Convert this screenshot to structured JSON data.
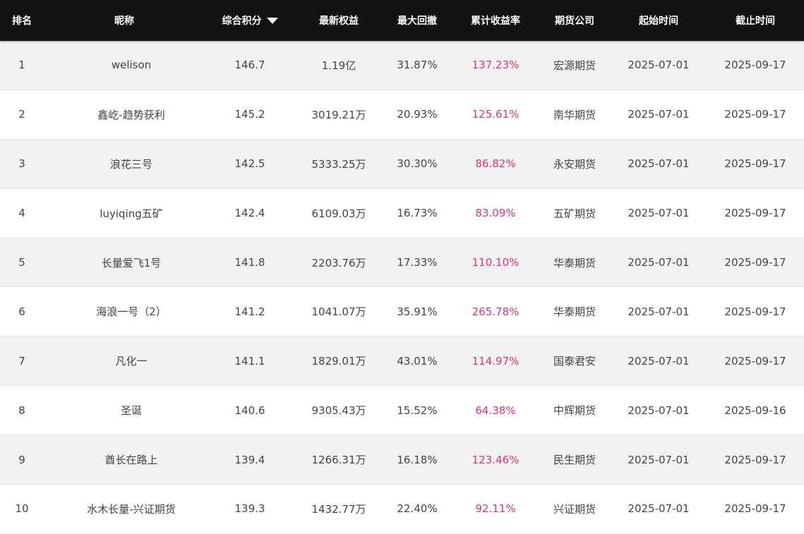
{
  "headers": {
    "rank": "排名",
    "nickname": "昵称",
    "score": "综合积分",
    "equity": "最新权益",
    "drawdown": "最大回撤",
    "return": "累计收益率",
    "company": "期货公司",
    "start": "起始时间",
    "end": "截止时间"
  },
  "sort_icon": "sort-down-triangle-icon",
  "colors": {
    "header_bg": "#121212",
    "return_color": "#e8317a",
    "row_alt_bg": "#f2f2f2"
  },
  "rows": [
    {
      "rank": "1",
      "nickname": "welison",
      "score": "146.7",
      "equity": "1.19亿",
      "drawdown": "31.87%",
      "return": "137.23%",
      "company": "宏源期货",
      "start": "2025-07-01",
      "end": "2025-09-17"
    },
    {
      "rank": "2",
      "nickname": "鑫屹-趋势获利",
      "score": "145.2",
      "equity": "3019.21万",
      "drawdown": "20.93%",
      "return": "125.61%",
      "company": "南华期货",
      "start": "2025-07-01",
      "end": "2025-09-17"
    },
    {
      "rank": "3",
      "nickname": "浪花三号",
      "score": "142.5",
      "equity": "5333.25万",
      "drawdown": "30.30%",
      "return": "86.82%",
      "company": "永安期货",
      "start": "2025-07-01",
      "end": "2025-09-17"
    },
    {
      "rank": "4",
      "nickname": "luyiqing五矿",
      "score": "142.4",
      "equity": "6109.03万",
      "drawdown": "16.73%",
      "return": "83.09%",
      "company": "五矿期货",
      "start": "2025-07-01",
      "end": "2025-09-17"
    },
    {
      "rank": "5",
      "nickname": "长量爱飞1号",
      "score": "141.8",
      "equity": "2203.76万",
      "drawdown": "17.33%",
      "return": "110.10%",
      "company": "华泰期货",
      "start": "2025-07-01",
      "end": "2025-09-17"
    },
    {
      "rank": "6",
      "nickname": "海浪一号（2）",
      "score": "141.2",
      "equity": "1041.07万",
      "drawdown": "35.91%",
      "return": "265.78%",
      "company": "华泰期货",
      "start": "2025-07-01",
      "end": "2025-09-17"
    },
    {
      "rank": "7",
      "nickname": "凡化一",
      "score": "141.1",
      "equity": "1829.01万",
      "drawdown": "43.01%",
      "return": "114.97%",
      "company": "国泰君安",
      "start": "2025-07-01",
      "end": "2025-09-17"
    },
    {
      "rank": "8",
      "nickname": "圣诞",
      "score": "140.6",
      "equity": "9305.43万",
      "drawdown": "15.52%",
      "return": "64.38%",
      "company": "中辉期货",
      "start": "2025-07-01",
      "end": "2025-09-16"
    },
    {
      "rank": "9",
      "nickname": "酋长在路上",
      "score": "139.4",
      "equity": "1266.31万",
      "drawdown": "16.18%",
      "return": "123.46%",
      "company": "民生期货",
      "start": "2025-07-01",
      "end": "2025-09-17"
    },
    {
      "rank": "10",
      "nickname": "水木长量-兴证期货",
      "score": "139.3",
      "equity": "1432.77万",
      "drawdown": "22.40%",
      "return": "92.11%",
      "company": "兴证期货",
      "start": "2025-07-01",
      "end": "2025-09-17"
    }
  ]
}
